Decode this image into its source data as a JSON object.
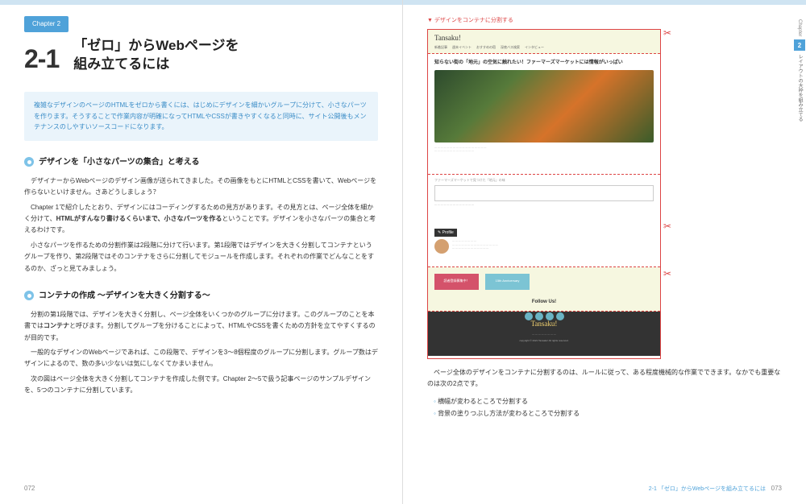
{
  "chapter_badge": "Chapter 2",
  "section_number": "2-1",
  "main_title_line1": "「ゼロ」からWebページを",
  "main_title_line2": "組み立てるには",
  "intro_text": "複雑なデザインのページのHTMLをゼロから書くには、はじめにデザインを細かいグループに分けて、小さなパーツを作ります。そうすることで作業内容が明確になってHTMLやCSSが書きやすくなると同時に、サイト公開後もメンテナンスのしやすいソースコードになります。",
  "subhead1": "デザインを「小さなパーツの集合」と考える",
  "para1": "デザイナーからWebページのデザイン画像が送られてきました。その画像をもとにHTMLとCSSを書いて、Webページを作らないといけません。さあどうしましょう？",
  "para2_pre": "Chapter 1で紹介したとおり、デザインにはコーディングするための見方があります。その見方とは、ページ全体を細かく分けて、",
  "para2_bold": "HTMLがすんなり書けるくらいまで、小さなパーツを作る",
  "para2_post": "ということです。デザインを小さなパーツの集合と考えるわけです。",
  "para3": "小さなパーツを作るための分割作業は2段階に分けて行います。第1段階ではデザインを大きく分割してコンテナというグループを作り、第2段階ではそのコンテナをさらに分割してモジュールを作成します。それぞれの作業でどんなことをするのか、ざっと見てみましょう。",
  "subhead2": "コンテナの作成 ～デザインを大きく分割する～",
  "para4_pre": "分割の第1段階では、デザインを大きく分割し、ページ全体をいくつかのグループに分けます。このグループのことを本書では",
  "para4_bold": "コンテナ",
  "para4_post": "と呼びます。分割してグループを分けることによって、HTMLやCSSを書くための方針を立てやすくするのが目的です。",
  "para5": "一般的なデザインのWebページであれば、この段階で、デザインを3～8個程度のグループに分割します。グループ数はデザインによるので、数の多い少ないは気にしなくてかまいません。",
  "para6": "次の図はページ全体を大きく分割してコンテナを作成した例です。Chapter 2～5で扱う記事ページのサンプルデザインを、5つのコンテナに分割しています。",
  "fig_caption": "デザインをコンテナに分割する",
  "mockup": {
    "logo": "Tansaku!",
    "nav": [
      "新着記事",
      "週末イベント",
      "おすすめの宿",
      "深夜バス検索",
      "インタビュー"
    ],
    "hero_title": "知らない街の「地元」の空気に触れたい！ファーマーズマーケットには情報がいっぱい",
    "mid_label": "ファーマーズマーケットで見つけた「地元」の味",
    "profile_label": "✎ Profile",
    "banner1": "読者登録募集中！",
    "banner2": "15th Anniversary",
    "follow": "Follow Us!",
    "footer_logo": "Tansaku!",
    "footer_copy": "copyright © 2021 Tansaku! All rights reserved."
  },
  "right_para1": "ページ全体のデザインをコンテナに分割するのは、ルールに従って、ある程度機械的な作業でできます。なかでも重要なのは次の2点です。",
  "bullets": [
    "横幅が変わるところで分割する",
    "背景の塗りつぶし方法が変わるところで分割する"
  ],
  "page_left_num": "072",
  "page_right_num": "073",
  "running_head": "2-1 「ゼロ」からWebページを組み立てるには",
  "side_tab": {
    "chapter": "Chapter",
    "num": "2",
    "text": "レイアウトの大枠を組み立てる"
  }
}
